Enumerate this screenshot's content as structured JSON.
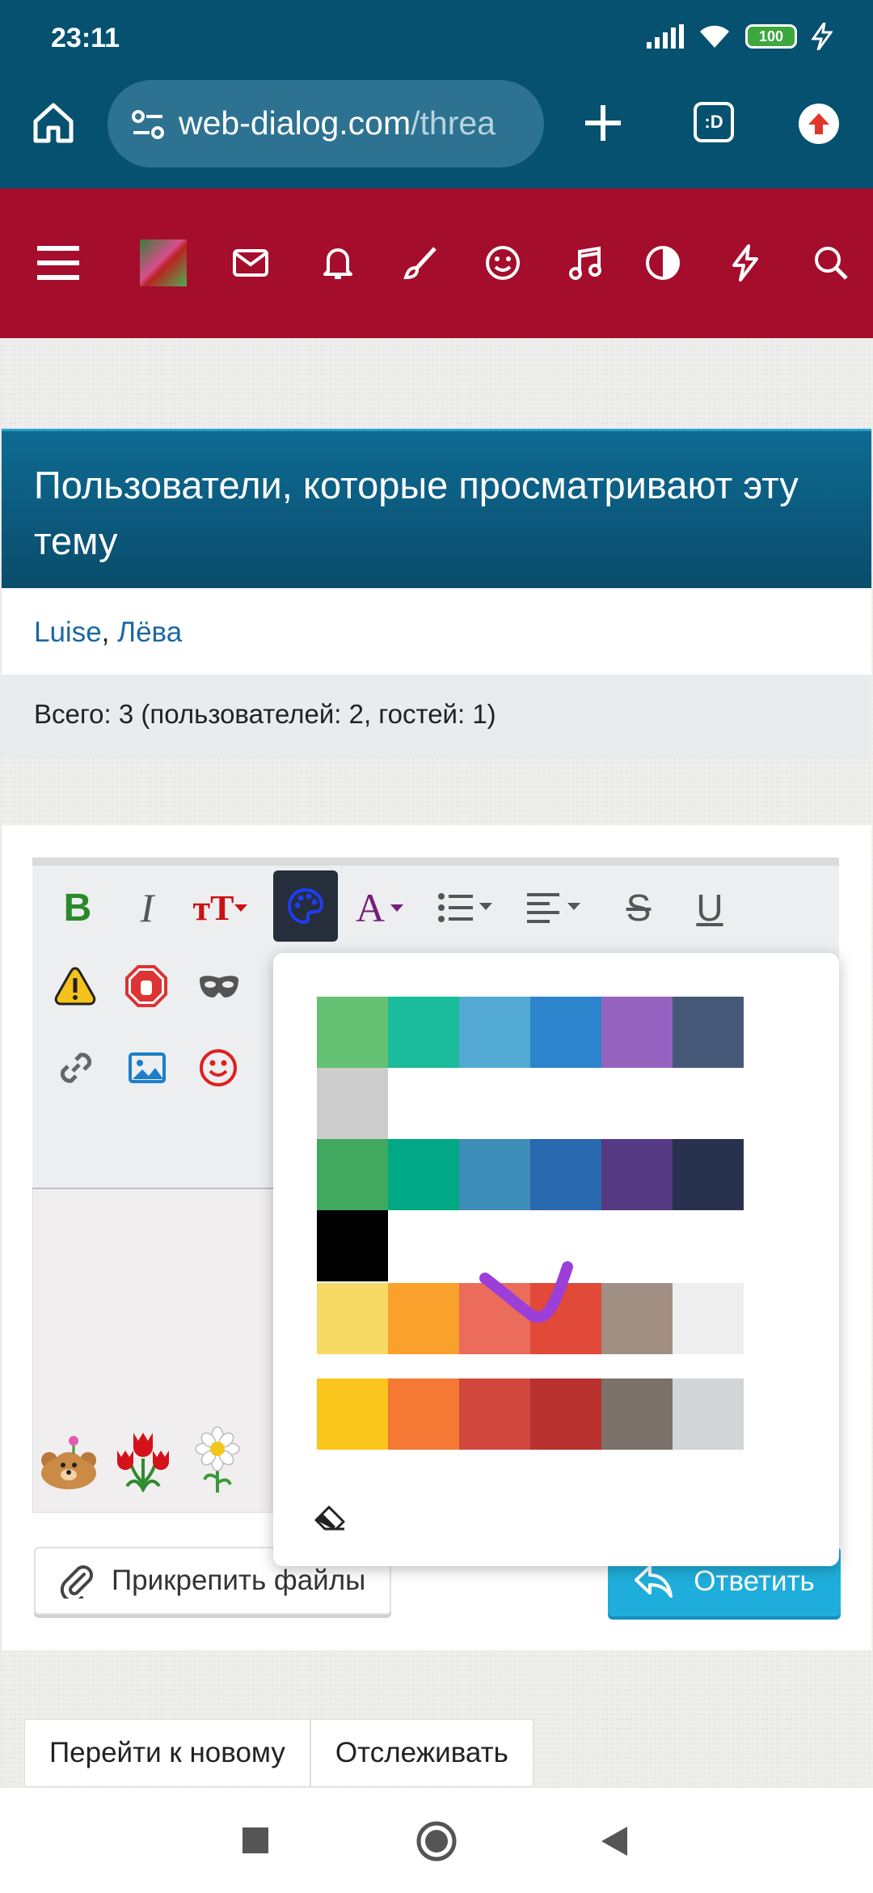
{
  "status": {
    "time": "23:11",
    "battery": "100"
  },
  "browser": {
    "url_host": "web-dialog.com",
    "url_path": "/threa",
    "tab_label": ":D"
  },
  "forum_nav": {
    "icons": [
      "menu-icon",
      "avatar",
      "mail-icon",
      "bell-icon",
      "brush-icon",
      "smile-icon",
      "music-icon",
      "contrast-icon",
      "bolt-icon",
      "search-icon"
    ]
  },
  "viewers": {
    "title": "Пользователи, которые просматривают эту тему",
    "user1": "Luise",
    "separator": ", ",
    "user2": "Лёва",
    "total": "Всего: 3 (пользователей: 2, гостей: 1)"
  },
  "toolbar": {
    "bold": "B",
    "italic": "I",
    "font_size": "тТ",
    "font_color": "A",
    "strike": "S",
    "underline": "U"
  },
  "palette": {
    "rows": [
      [
        "#65c174",
        "#1abc9c",
        "#53aad3",
        "#2b84cc",
        "#9563bf",
        "#475979",
        "#cccccc"
      ],
      [
        "#41a85f",
        "#00a885",
        "#3d8eb9",
        "#2969b0",
        "#553982",
        "#28324e",
        "#000000"
      ],
      [
        "#f7da64",
        "#faa02c",
        "#eb6c5a",
        "#e14938",
        "#a28f84",
        "#efefef"
      ],
      [
        "#fac51c",
        "#f37935",
        "#d1473e",
        "#b9312e",
        "#7c706b",
        "#d1d5d8"
      ]
    ],
    "annotation_color": "#9b3fd8"
  },
  "actions": {
    "attach": "Прикрепить файлы",
    "reply": "Ответить",
    "go_new": "Перейти к новому",
    "watch": "Отслеживать"
  },
  "colors": {
    "brand_red": "#a50d2c",
    "chrome_blue": "#05516f",
    "reply_blue": "#1faedb"
  }
}
